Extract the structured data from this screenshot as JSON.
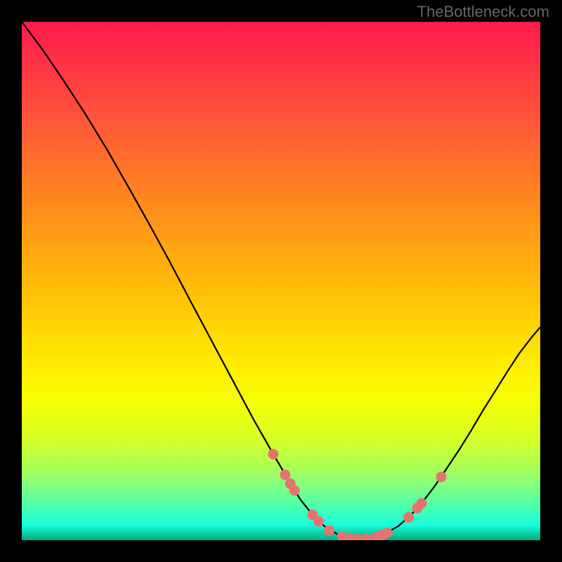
{
  "watermark": "TheBottleneck.com",
  "chart_data": {
    "type": "line",
    "title": "",
    "xlabel": "",
    "ylabel": "",
    "xlim": [
      0,
      100
    ],
    "ylim": [
      0,
      100
    ],
    "curve": {
      "name": "bottleneck-curve",
      "points": [
        {
          "x": 0.0,
          "y": 100.0
        },
        {
          "x": 4.1,
          "y": 94.5
        },
        {
          "x": 8.1,
          "y": 88.6
        },
        {
          "x": 12.2,
          "y": 82.3
        },
        {
          "x": 16.3,
          "y": 75.6
        },
        {
          "x": 20.3,
          "y": 68.6
        },
        {
          "x": 24.4,
          "y": 61.3
        },
        {
          "x": 28.5,
          "y": 53.8
        },
        {
          "x": 32.5,
          "y": 46.2
        },
        {
          "x": 36.6,
          "y": 38.5
        },
        {
          "x": 40.7,
          "y": 30.8
        },
        {
          "x": 44.7,
          "y": 23.3
        },
        {
          "x": 48.8,
          "y": 16.1
        },
        {
          "x": 51.4,
          "y": 11.7
        },
        {
          "x": 53.7,
          "y": 7.9
        },
        {
          "x": 56.1,
          "y": 4.9
        },
        {
          "x": 58.5,
          "y": 2.6
        },
        {
          "x": 61.0,
          "y": 1.1
        },
        {
          "x": 63.8,
          "y": 0.3
        },
        {
          "x": 66.9,
          "y": 0.3
        },
        {
          "x": 69.9,
          "y": 1.2
        },
        {
          "x": 72.6,
          "y": 2.7
        },
        {
          "x": 75.1,
          "y": 4.9
        },
        {
          "x": 77.4,
          "y": 7.5
        },
        {
          "x": 79.7,
          "y": 10.5
        },
        {
          "x": 82.0,
          "y": 13.9
        },
        {
          "x": 84.4,
          "y": 17.5
        },
        {
          "x": 86.7,
          "y": 21.2
        },
        {
          "x": 89.0,
          "y": 25.1
        },
        {
          "x": 91.4,
          "y": 28.9
        },
        {
          "x": 93.7,
          "y": 32.6
        },
        {
          "x": 96.0,
          "y": 36.1
        },
        {
          "x": 98.4,
          "y": 39.2
        },
        {
          "x": 100.0,
          "y": 41.1
        }
      ]
    },
    "markers": {
      "name": "highlight-points",
      "color": "#e6746e",
      "points": [
        {
          "x": 48.5,
          "y": 16.6
        },
        {
          "x": 50.8,
          "y": 12.6
        },
        {
          "x": 51.8,
          "y": 10.9
        },
        {
          "x": 52.6,
          "y": 9.6
        },
        {
          "x": 56.1,
          "y": 4.9
        },
        {
          "x": 57.3,
          "y": 3.6
        },
        {
          "x": 59.3,
          "y": 1.9
        },
        {
          "x": 61.8,
          "y": 0.7
        },
        {
          "x": 63.4,
          "y": 0.3
        },
        {
          "x": 64.8,
          "y": 0.2
        },
        {
          "x": 66.5,
          "y": 0.3
        },
        {
          "x": 68.5,
          "y": 0.7
        },
        {
          "x": 69.6,
          "y": 1.0
        },
        {
          "x": 70.5,
          "y": 1.4
        },
        {
          "x": 74.6,
          "y": 4.4
        },
        {
          "x": 76.3,
          "y": 6.2
        },
        {
          "x": 77.1,
          "y": 7.1
        },
        {
          "x": 80.9,
          "y": 12.2
        }
      ]
    }
  }
}
